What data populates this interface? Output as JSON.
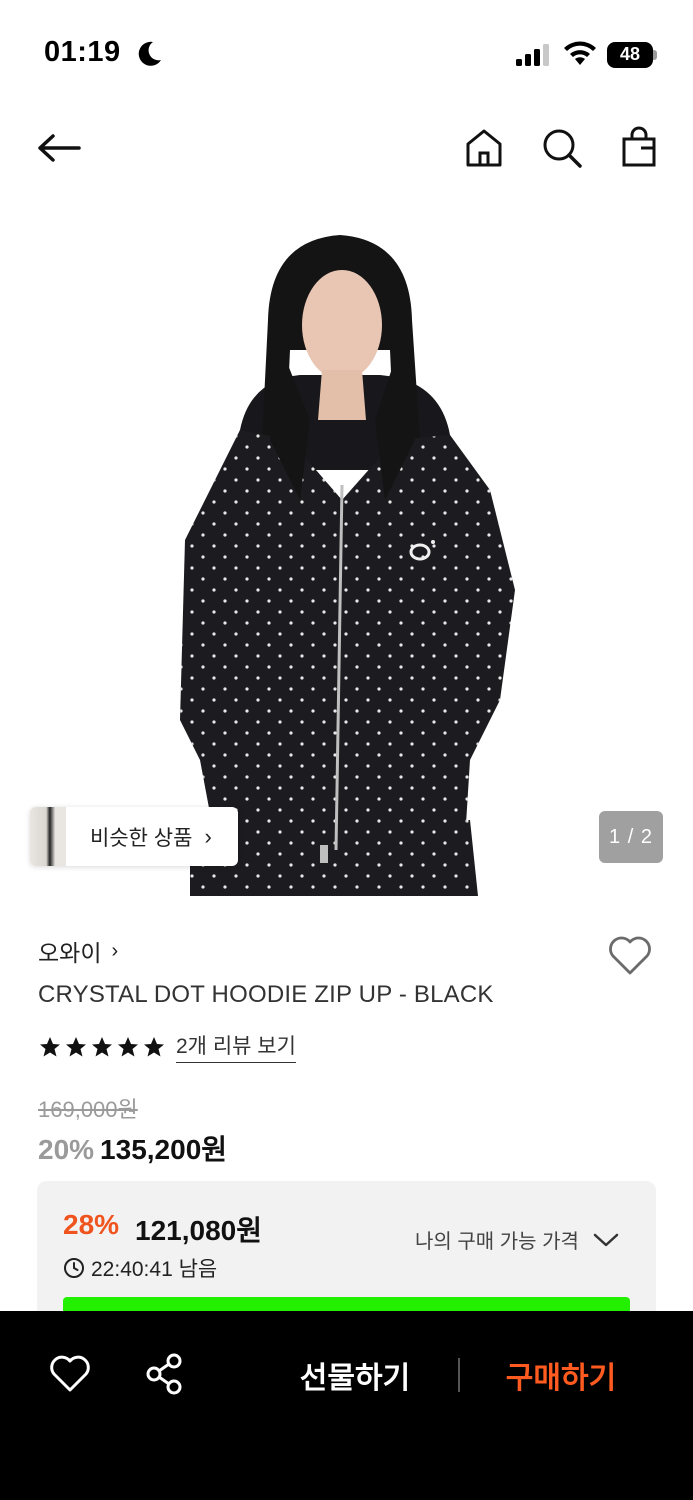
{
  "status_bar": {
    "time": "01:19",
    "battery": "48",
    "icons": [
      "moon-icon",
      "signal-icon",
      "wifi-icon",
      "battery-icon"
    ]
  },
  "nav": {
    "icons": [
      "back-arrow-icon",
      "home-icon",
      "search-icon",
      "shopping-bag-icon"
    ]
  },
  "gallery": {
    "similar_label": "비슷한 상품",
    "page_indicator": "1 / 2"
  },
  "product": {
    "brand": "오와이",
    "title": "CRYSTAL DOT HOODIE ZIP UP - BLACK",
    "rating_stars": 5,
    "review_link": "2개 리뷰 보기",
    "original_price": "169,000원",
    "discount_rate": "20%",
    "sale_price": "135,200원"
  },
  "my_price": {
    "rate": "28%",
    "price": "121,080원",
    "timer": "22:40:41 남음",
    "toggle_label": "나의 구매 가능 가격"
  },
  "bottom_bar": {
    "gift_label": "선물하기",
    "buy_label": "구매하기",
    "icons": [
      "heart-icon",
      "share-icon"
    ]
  },
  "colors": {
    "accent_orange": "#f0541e",
    "buy_orange": "#ff5a1f",
    "progress_green": "#22f000",
    "bottom_bar_bg": "#000000"
  }
}
